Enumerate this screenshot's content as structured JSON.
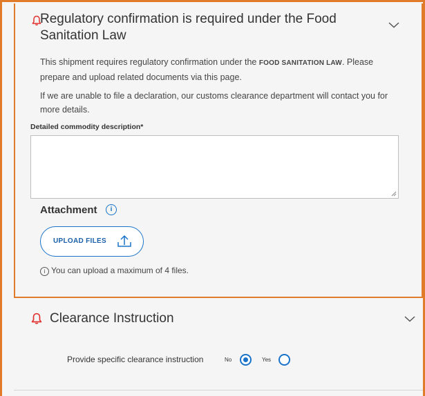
{
  "food_section": {
    "title": "Regulatory confirmation is required under the Food Sanitation Law",
    "para1_pre": "This shipment requires regulatory confirmation under the",
    "para1_bold": "FOOD SANITATION LAW",
    "para1_post": ". Please prepare and upload related documents via this page.",
    "para2": "If we are unable to file a declaration, our customs clearance department will contact you for more details.",
    "desc_label": "Detailed commodity description*",
    "desc_value": "",
    "attachment_label": "Attachment",
    "upload_label": "UPLOAD FILES",
    "max_note": "You can upload a maximum of 4 files."
  },
  "clearance_section": {
    "title": "Clearance Instruction",
    "question": "Provide specific clearance instruction",
    "options": [
      {
        "label": "No",
        "selected": true
      },
      {
        "label": "Yes",
        "selected": false
      }
    ]
  },
  "colors": {
    "accent": "#1a73c9",
    "warning": "#e0312f",
    "highlight_border": "#e07b2a"
  },
  "icons": [
    "bell-icon",
    "chevron-down-icon",
    "info-icon",
    "upload-icon"
  ]
}
